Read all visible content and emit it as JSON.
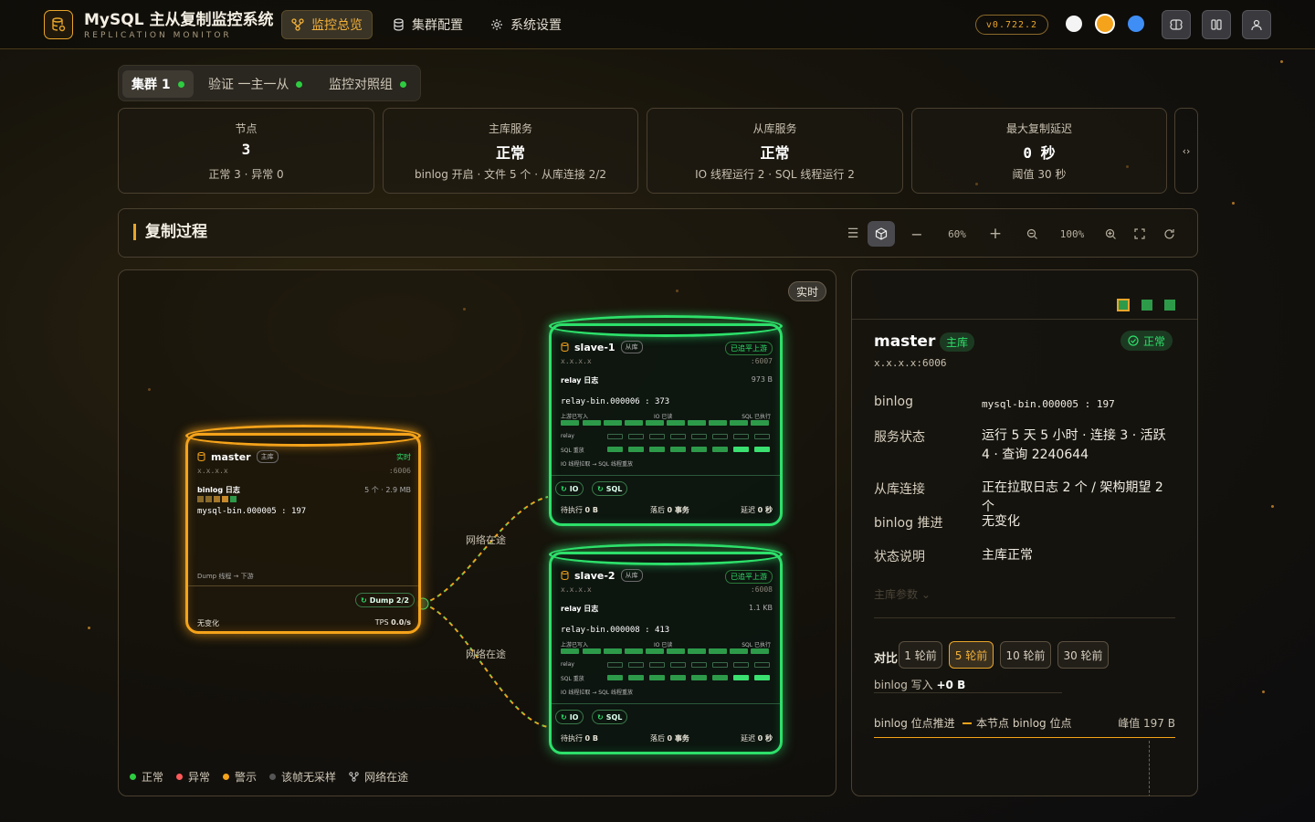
{
  "app": {
    "title": "MySQL 主从复制监控系统",
    "subtitle": "REPLICATION MONITOR",
    "version": "v0.722.2"
  },
  "nav": [
    {
      "label": "监控总览",
      "icon": "topology-icon"
    },
    {
      "label": "集群配置",
      "icon": "database-icon"
    },
    {
      "label": "系统设置",
      "icon": "gear-icon"
    }
  ],
  "cluster_tabs": [
    {
      "label": "集群 1"
    },
    {
      "label": "验证 一主一从"
    },
    {
      "label": "监控对照组"
    }
  ],
  "stats": [
    {
      "label": "节点",
      "value": "3",
      "sub": "正常 3 · 异常 0"
    },
    {
      "label": "主库服务",
      "value": "正常",
      "sub": "binlog 开启 · 文件 5 个 · 从库连接 2/2"
    },
    {
      "label": "从库服务",
      "value": "正常",
      "sub": "IO 线程运行 2 · SQL 线程运行 2"
    },
    {
      "label": "最大复制延迟",
      "value": "0 秒",
      "sub": "阈值 30 秒"
    }
  ],
  "process": {
    "title": "复制过程",
    "zoom_a": "60%",
    "zoom_b": "100%"
  },
  "canvas": {
    "live_label": "实时",
    "master": {
      "name": "master",
      "role": "主库",
      "status": "实时",
      "host": "x.x.x.x",
      "port": ":6006",
      "binlog_label": "binlog 日志",
      "binlog_meta": "5 个 · 2.9 MB",
      "binlog_pos": "mysql-bin.000005 : 197",
      "dump_label": "Dump 线程 → 下游",
      "dump_pill": "Dump 2/2",
      "change": "无变化",
      "tps_label": "TPS",
      "tps": "0.0/s"
    },
    "slaves": [
      {
        "name": "slave-1",
        "role": "从库",
        "status": "已追平上游",
        "host": "x.x.x.x",
        "port": ":6007",
        "relay_label": "relay 日志",
        "relay_size": "973 B",
        "relay_pos": "relay-bin.000006 : 373",
        "up_label": "上游已写入",
        "io_label": "IO 已读",
        "sql_label": "SQL 已执行",
        "relay_row": "relay",
        "sql_row": "SQL 重放",
        "flow": "IO 线程拉取 → SQL 线程重放",
        "io_pill": "IO",
        "sql_pill": "SQL",
        "pending_label": "待执行",
        "pending": "0 B",
        "behind_label": "落后",
        "behind": "0 事务",
        "delay_label": "延迟",
        "delay": "0 秒"
      },
      {
        "name": "slave-2",
        "role": "从库",
        "status": "已追平上游",
        "host": "x.x.x.x",
        "port": ":6008",
        "relay_label": "relay 日志",
        "relay_size": "1.1 KB",
        "relay_pos": "relay-bin.000008 : 413",
        "up_label": "上游已写入",
        "io_label": "IO 已读",
        "sql_label": "SQL 已执行",
        "relay_row": "relay",
        "sql_row": "SQL 重放",
        "flow": "IO 线程拉取 → SQL 线程重放",
        "io_pill": "IO",
        "sql_pill": "SQL",
        "pending_label": "待执行",
        "pending": "0 B",
        "behind_label": "落后",
        "behind": "0 事务",
        "delay_label": "延迟",
        "delay": "0 秒"
      }
    ],
    "net_label": "网络在途",
    "legend": [
      {
        "label": "正常",
        "color": "#2ecc40"
      },
      {
        "label": "异常",
        "color": "#ff5a5a"
      },
      {
        "label": "警示",
        "color": "#f5a31a"
      },
      {
        "label": "该帧无采样",
        "color": "#555555"
      },
      {
        "label": "网络在途",
        "color": "icon"
      }
    ]
  },
  "detail": {
    "name": "master",
    "role": "主库",
    "status": "正常",
    "addr": "x.x.x.x:6006",
    "rows": [
      {
        "k": "binlog",
        "v": "mysql-bin.000005 : 197"
      },
      {
        "k": "服务状态",
        "v": "运行 5 天 5 小时 · 连接 3 · 活跃 4 · 查询 2240644"
      },
      {
        "k": "从库连接",
        "v": "正在拉取日志 2 个 / 架构期望 2 个"
      },
      {
        "k": "binlog 推进",
        "v": "无变化"
      },
      {
        "k": "状态说明",
        "v": "主库正常"
      }
    ],
    "params_label": "主库参数",
    "compare_label": "对比",
    "compare": [
      "1 轮前",
      "5 轮前",
      "10 轮前",
      "30 轮前"
    ],
    "compare_active": "5 轮前",
    "binlog_write_label": "binlog 写入",
    "binlog_write": "+0 B",
    "chart_title": "binlog 位点推进",
    "chart_legend": "本节点 binlog 位点",
    "chart_peak": "峰值 197 B"
  }
}
